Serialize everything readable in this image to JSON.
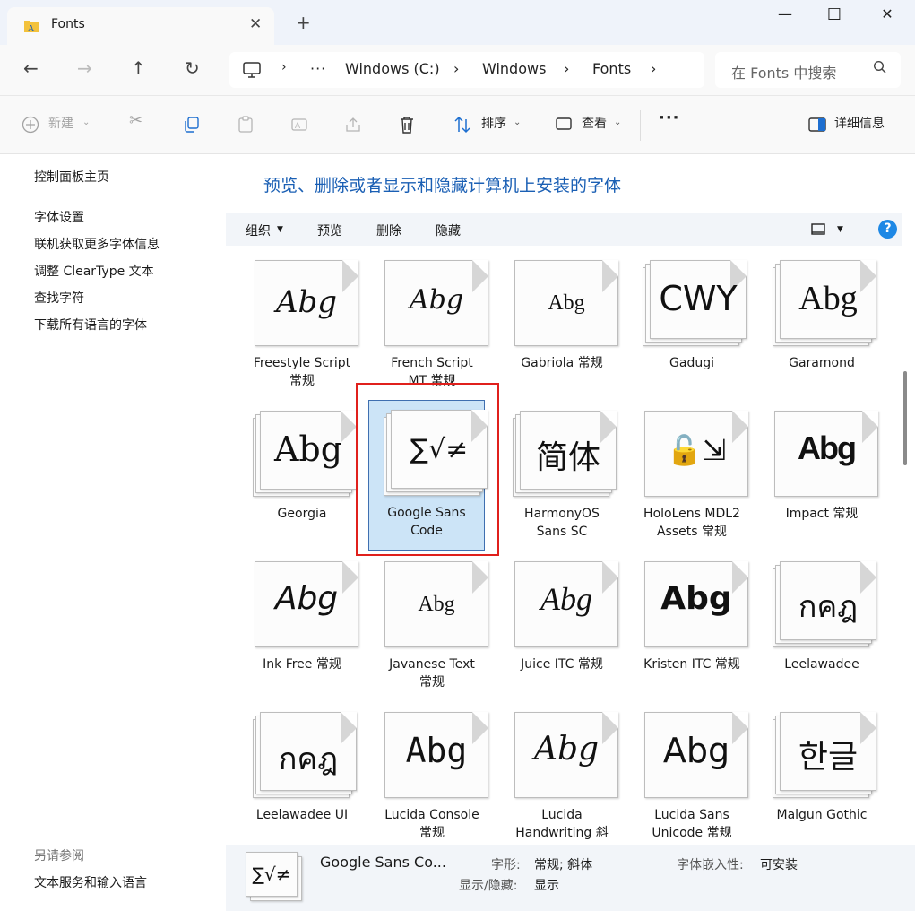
{
  "window": {
    "tab_title": "Fonts",
    "tab_close": "✕",
    "new_tab": "+",
    "minimize": "—",
    "maximize": "☐",
    "close": "✕"
  },
  "navigation": {
    "back": "←",
    "forward": "→",
    "up": "↑",
    "refresh": "↻",
    "breadcrumb": [
      "Windows (C:)",
      "Windows",
      "Fonts"
    ],
    "more": "···",
    "search_placeholder": "在 Fonts 中搜索"
  },
  "commands": {
    "new": "新建",
    "sort": "排序",
    "view": "查看",
    "more": "···",
    "details": "详细信息"
  },
  "sidebar": {
    "home": "控制面板主页",
    "links": [
      "字体设置",
      "联机获取更多字体信息",
      "调整 ClearType 文本",
      "查找字符",
      "下载所有语言的字体"
    ],
    "see_also_title": "另请参阅",
    "see_also_link": "文本服务和输入语言"
  },
  "content": {
    "heading": "预览、删除或者显示和隐藏计算机上安装的字体",
    "toolbar": {
      "organize": "组织",
      "preview": "预览",
      "delete": "删除",
      "hide": "隐藏",
      "help": "?"
    }
  },
  "fonts": [
    {
      "name": "Freestyle Script\n常规",
      "sample": "Abg",
      "stack": false,
      "selected": false
    },
    {
      "name": "French Script\nMT 常规",
      "sample": "Abg",
      "stack": false,
      "selected": false
    },
    {
      "name": "Gabriola 常规",
      "sample": "Abg",
      "stack": false,
      "selected": false
    },
    {
      "name": "Gadugi",
      "sample": "CWY",
      "stack": true,
      "selected": false
    },
    {
      "name": "Garamond",
      "sample": "Abg",
      "stack": true,
      "selected": false
    },
    {
      "name": "Georgia",
      "sample": "Abg",
      "stack": true,
      "selected": false
    },
    {
      "name": "Google Sans\nCode",
      "sample": "∑√≠",
      "stack": true,
      "selected": true
    },
    {
      "name": "HarmonyOS\nSans SC",
      "sample": "简体",
      "stack": true,
      "selected": false
    },
    {
      "name": "HoloLens MDL2\nAssets 常规",
      "sample": "🔓⇲",
      "stack": false,
      "selected": false
    },
    {
      "name": "Impact 常规",
      "sample": "Abg",
      "stack": false,
      "selected": false
    },
    {
      "name": "Ink Free 常规",
      "sample": "Abg",
      "stack": false,
      "selected": false
    },
    {
      "name": "Javanese Text\n常规",
      "sample": "Abg",
      "stack": false,
      "selected": false
    },
    {
      "name": "Juice ITC 常规",
      "sample": "Abg",
      "stack": false,
      "selected": false
    },
    {
      "name": "Kristen ITC 常规",
      "sample": "Abg",
      "stack": false,
      "selected": false
    },
    {
      "name": "Leelawadee",
      "sample": "กคฎ",
      "stack": true,
      "selected": false
    },
    {
      "name": "Leelawadee UI",
      "sample": "กคฎ",
      "stack": true,
      "selected": false
    },
    {
      "name": "Lucida Console\n常规",
      "sample": "Abg",
      "stack": false,
      "selected": false
    },
    {
      "name": "Lucida\nHandwriting 斜",
      "sample": "Abg",
      "stack": false,
      "selected": false
    },
    {
      "name": "Lucida Sans\nUnicode 常规",
      "sample": "Abg",
      "stack": false,
      "selected": false
    },
    {
      "name": "Malgun Gothic",
      "sample": "한글",
      "stack": true,
      "selected": false
    }
  ],
  "details": {
    "name": "Google Sans Co...",
    "sample": "∑√≠",
    "style_label": "字形:",
    "style_value": "常规; 斜体",
    "embed_label": "字体嵌入性:",
    "embed_value": "可安装",
    "visibility_label": "显示/隐藏:",
    "visibility_value": "显示"
  }
}
